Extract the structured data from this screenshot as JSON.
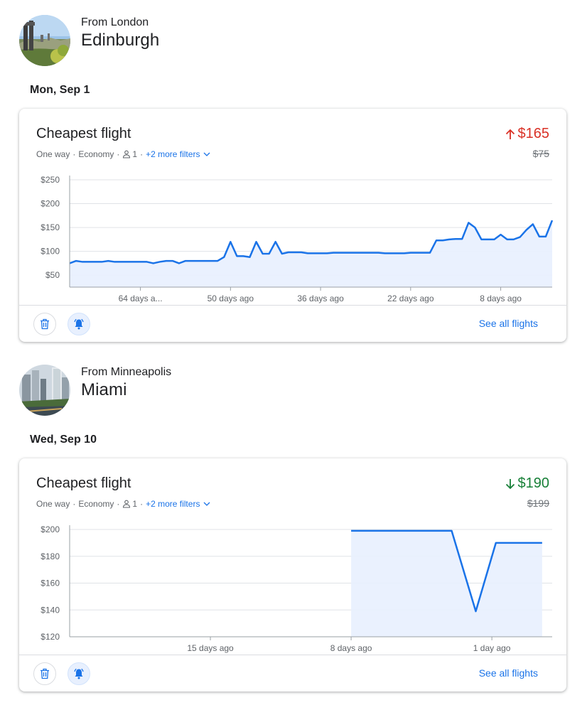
{
  "routes": [
    {
      "from": "From London",
      "destination": "Edinburgh",
      "date": "Mon, Sep 1",
      "card": {
        "title": "Cheapest flight",
        "trip_type": "One way",
        "cabin": "Economy",
        "passengers": "1",
        "more_filters": "+2 more filters",
        "price": "$165",
        "price_trend": "up",
        "old_price": "$75",
        "see_all": "See all flights"
      }
    },
    {
      "from": "From Minneapolis",
      "destination": "Miami",
      "date": "Wed, Sep 10",
      "card": {
        "title": "Cheapest flight",
        "trip_type": "One way",
        "cabin": "Economy",
        "passengers": "1",
        "more_filters": "+2 more filters",
        "price": "$190",
        "price_trend": "down",
        "old_price": "$199",
        "see_all": "See all flights"
      }
    }
  ],
  "icons": {
    "delete": "trash-icon",
    "alert": "bell-icon",
    "passenger": "person-icon",
    "dropdown": "chevron-down-icon",
    "trend_up": "arrow-up-icon",
    "trend_down": "arrow-down-icon"
  },
  "colors": {
    "line": "#1a73e8",
    "fill": "#e8f0fe",
    "price_up": "#d93025",
    "price_down": "#188038",
    "link": "#1a73e8"
  },
  "chart_data": [
    {
      "type": "area",
      "title": "",
      "xlabel": "",
      "ylabel": "",
      "x_unit": "days ago",
      "xlim": [
        75,
        0
      ],
      "ylim": [
        25,
        250
      ],
      "y_ticks": [
        50,
        100,
        150,
        200,
        250
      ],
      "y_tick_labels": [
        "$50",
        "$100",
        "$150",
        "$200",
        "$250"
      ],
      "x_ticks": [
        64,
        50,
        36,
        22,
        8
      ],
      "x_tick_labels": [
        "64 days a...",
        "50 days ago",
        "36 days ago",
        "22 days ago",
        "8 days ago"
      ],
      "grid": true,
      "x": [
        75,
        74,
        73,
        72,
        71,
        70,
        69,
        68,
        67,
        66,
        65,
        64,
        63,
        62,
        61,
        60,
        59,
        58,
        57,
        56,
        55,
        54,
        53,
        52,
        51,
        50,
        49,
        48,
        47,
        46,
        45,
        44,
        43,
        42,
        41,
        40,
        39,
        38,
        37,
        36,
        35,
        34,
        33,
        32,
        31,
        30,
        29,
        28,
        27,
        26,
        25,
        24,
        23,
        22,
        21,
        20,
        19,
        18,
        17,
        16,
        15,
        14,
        13,
        12,
        11,
        10,
        9,
        8,
        7,
        6,
        5,
        4,
        3,
        2,
        1,
        0
      ],
      "values": [
        75,
        80,
        78,
        78,
        78,
        78,
        80,
        78,
        78,
        78,
        78,
        78,
        78,
        75,
        78,
        80,
        80,
        75,
        80,
        80,
        80,
        80,
        80,
        80,
        88,
        120,
        90,
        90,
        88,
        120,
        95,
        95,
        120,
        95,
        98,
        98,
        98,
        96,
        96,
        96,
        96,
        97,
        97,
        97,
        97,
        97,
        97,
        97,
        97,
        96,
        96,
        96,
        96,
        97,
        97,
        97,
        97,
        123,
        123,
        125,
        126,
        126,
        160,
        150,
        125,
        125,
        125,
        135,
        125,
        125,
        130,
        145,
        157,
        131,
        131,
        165
      ]
    },
    {
      "type": "area",
      "title": "",
      "xlabel": "",
      "ylabel": "",
      "x_unit": "days ago",
      "xlim": [
        22,
        -2
      ],
      "ylim": [
        120,
        200
      ],
      "y_ticks": [
        120,
        140,
        160,
        180,
        200
      ],
      "y_tick_labels": [
        "$120",
        "$140",
        "$160",
        "$180",
        "$200"
      ],
      "x_ticks": [
        15,
        8,
        1
      ],
      "x_tick_labels": [
        "15 days ago",
        "8 days ago",
        "1 day ago"
      ],
      "grid": true,
      "x": [
        8,
        3,
        1.8,
        0.8,
        -1.5
      ],
      "values": [
        199,
        199,
        139,
        190,
        190
      ]
    }
  ]
}
